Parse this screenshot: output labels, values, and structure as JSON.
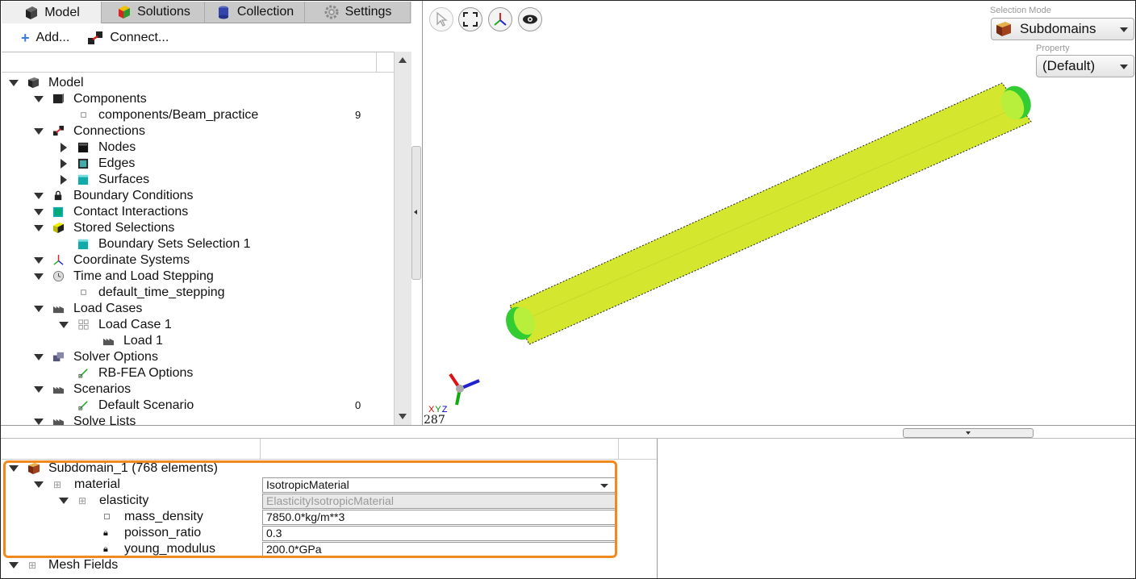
{
  "tabs": [
    {
      "label": "Model",
      "icon": "cube-icon",
      "active": true
    },
    {
      "label": "Solutions",
      "icon": "solutions-cube-icon",
      "active": false
    },
    {
      "label": "Collection",
      "icon": "collection-icon",
      "active": false
    },
    {
      "label": "Settings",
      "icon": "gear-icon",
      "active": false
    }
  ],
  "toolbar": {
    "add_label": "Add...",
    "connect_label": "Connect..."
  },
  "tree": [
    {
      "label": "Model",
      "level": 0,
      "expand": "down",
      "icon": "model-cube-icon"
    },
    {
      "label": "Components",
      "level": 1,
      "expand": "down",
      "icon": "components-cube-icon"
    },
    {
      "label": "components/Beam_practice",
      "level": 2,
      "expand": "none",
      "icon": "leaf-dot-icon",
      "value": "9"
    },
    {
      "label": "Connections",
      "level": 1,
      "expand": "down",
      "icon": "connections-icon"
    },
    {
      "label": "Nodes",
      "level": 2,
      "expand": "right",
      "icon": "nodes-cube-icon"
    },
    {
      "label": "Edges",
      "level": 2,
      "expand": "right",
      "icon": "edges-cube-icon"
    },
    {
      "label": "Surfaces",
      "level": 2,
      "expand": "right",
      "icon": "surfaces-cube-icon"
    },
    {
      "label": "Boundary Conditions",
      "level": 1,
      "expand": "down",
      "icon": "lock-icon"
    },
    {
      "label": "Contact Interactions",
      "level": 1,
      "expand": "down",
      "icon": "contact-icon"
    },
    {
      "label": "Stored Selections",
      "level": 1,
      "expand": "down",
      "icon": "selection-cube-icon"
    },
    {
      "label": "Boundary Sets Selection 1",
      "level": 2,
      "expand": "none",
      "icon": "boundary-set-icon"
    },
    {
      "label": "Coordinate Systems",
      "level": 1,
      "expand": "down",
      "icon": "axes-icon"
    },
    {
      "label": "Time and Load Stepping",
      "level": 1,
      "expand": "down",
      "icon": "clock-icon"
    },
    {
      "label": "default_time_stepping",
      "level": 2,
      "expand": "none",
      "icon": "leaf-dot-icon"
    },
    {
      "label": "Load Cases",
      "level": 1,
      "expand": "down",
      "icon": "factory-icon"
    },
    {
      "label": "Load Case 1",
      "level": 2,
      "expand": "down",
      "icon": "grid-icon"
    },
    {
      "label": "Load 1",
      "level": 3,
      "expand": "none",
      "icon": "factory-icon"
    },
    {
      "label": "Solver Options",
      "level": 1,
      "expand": "down",
      "icon": "solver-icon"
    },
    {
      "label": "RB-FEA Options",
      "level": 2,
      "expand": "none",
      "icon": "pencil-check-icon"
    },
    {
      "label": "Scenarios",
      "level": 1,
      "expand": "down",
      "icon": "factory-icon"
    },
    {
      "label": "Default Scenario",
      "level": 2,
      "expand": "none",
      "icon": "pencil-check-icon",
      "value": "0"
    },
    {
      "label": "Solve Lists",
      "level": 1,
      "expand": "down",
      "icon": "factory-icon"
    }
  ],
  "viewport": {
    "selection_mode_label": "Selection Mode",
    "selection_mode_value": "Subdomains",
    "property_label": "Property",
    "property_value": "(Default)",
    "axis_x": "X",
    "axis_y": "Y",
    "axis_z": "Z",
    "frame_counter": "287",
    "beam_color": "#d4e62e",
    "end_cap_color": "#33cc33"
  },
  "props": {
    "subdomain_label": "Subdomain_1 (768 elements)",
    "material_label": "material",
    "material_value": "IsotropicMaterial",
    "elasticity_label": "elasticity",
    "elasticity_value": "ElasticityIsotropicMaterial",
    "mass_density_label": "mass_density",
    "mass_density_value": "7850.0*kg/m**3",
    "poisson_label": "poisson_ratio",
    "poisson_value": "0.3",
    "young_label": "young_modulus",
    "young_value": "200.0*GPa",
    "mesh_fields_label": "Mesh Fields"
  },
  "colors": {
    "highlight": "#f08a1e"
  }
}
